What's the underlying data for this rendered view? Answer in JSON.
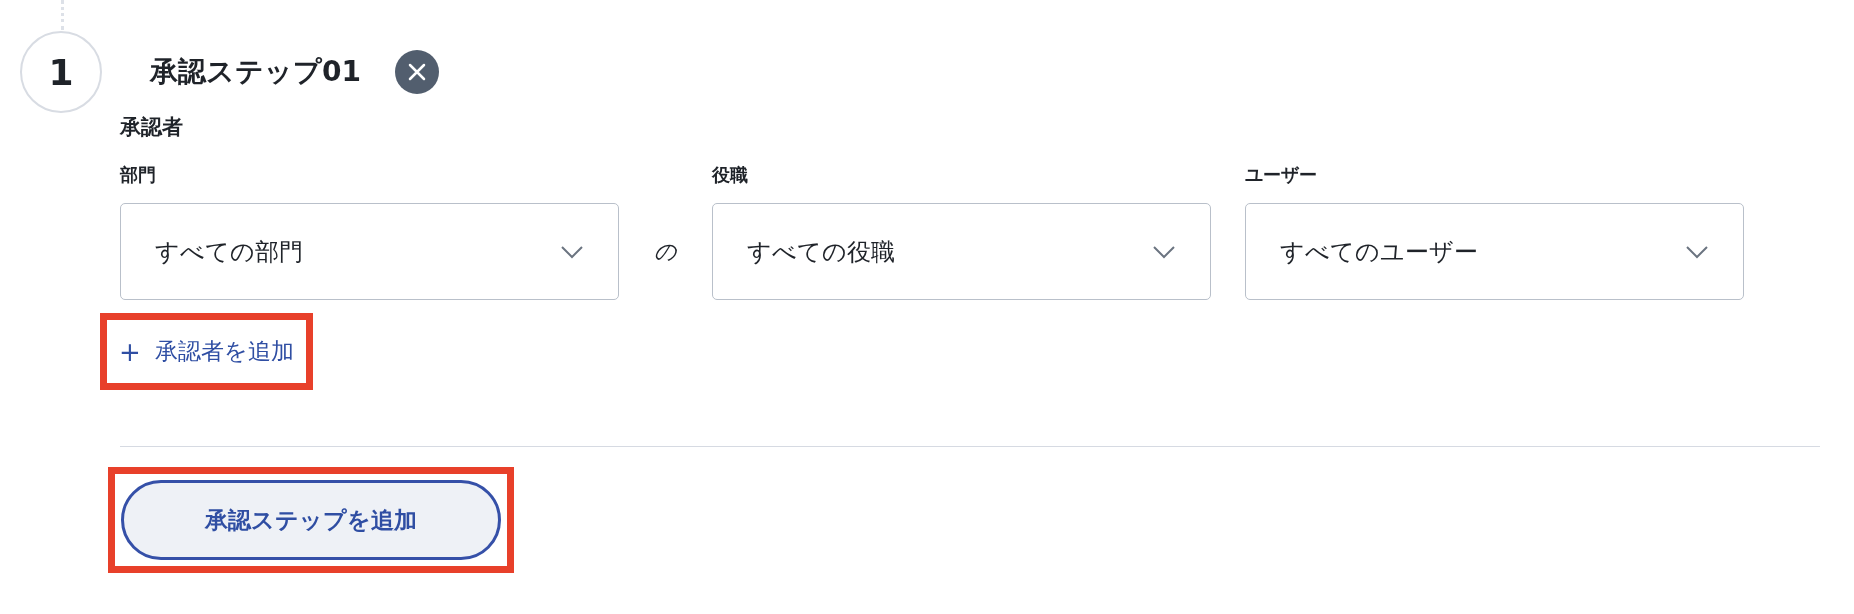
{
  "step": {
    "number": "1",
    "title": "承認ステップ01",
    "approvers_label": "承認者",
    "fields": [
      {
        "label": "部門",
        "value": "すべての部門",
        "connector": "の"
      },
      {
        "label": "役職",
        "value": "すべての役職"
      },
      {
        "label": "ユーザー",
        "value": "すべてのユーザー"
      }
    ],
    "add_approver": {
      "icon": "+",
      "label": "承認者を追加",
      "highlighted": true
    }
  },
  "add_step_button": {
    "label": "承認ステップを追加",
    "highlighted": true
  }
}
